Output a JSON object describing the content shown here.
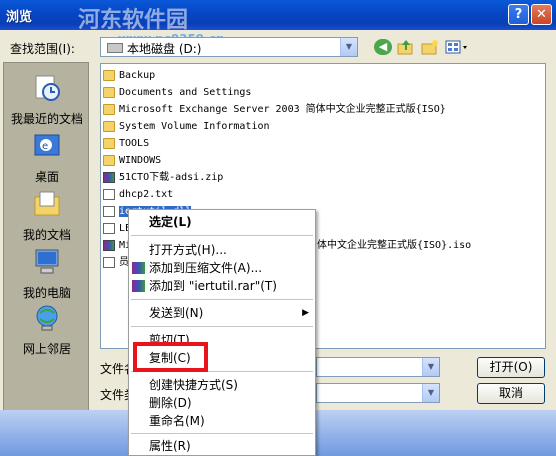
{
  "window": {
    "title": "浏览",
    "help_glyph": "?",
    "close_glyph": "✕",
    "watermark": "河东软件园",
    "watermark_url": "www.pc0359.cn"
  },
  "lookin": {
    "label": "查找范围(I):",
    "value": "本地磁盘 (D:)"
  },
  "places": [
    {
      "label": "我最近的文档",
      "icon": "recent-documents-icon"
    },
    {
      "label": "桌面",
      "icon": "desktop-icon"
    },
    {
      "label": "我的文档",
      "icon": "my-documents-icon"
    },
    {
      "label": "我的电脑",
      "icon": "my-computer-icon"
    },
    {
      "label": "网上邻居",
      "icon": "network-places-icon"
    }
  ],
  "files": [
    {
      "name": "Backup",
      "type": "folder"
    },
    {
      "name": "Documents and Settings",
      "type": "folder"
    },
    {
      "name": "Microsoft Exchange Server 2003 简体中文企业完整正式版{ISO}",
      "type": "folder"
    },
    {
      "name": "System Volume Information",
      "type": "folder"
    },
    {
      "name": "TOOLS",
      "type": "folder"
    },
    {
      "name": "WINDOWS",
      "type": "folder"
    },
    {
      "name": "51CTO下载-adsi.zip",
      "type": "zip"
    },
    {
      "name": "dhcp2.txt",
      "type": "txt"
    },
    {
      "name": "iertutil.dll",
      "type": "dll",
      "partial": "i"
    },
    {
      "name": "LE",
      "type": "file",
      "partial": "LE"
    },
    {
      "name": "Mi",
      "type": "iso",
      "partial": "Mi",
      "tail": "体中文企业完整正式版{ISO}.iso"
    },
    {
      "name": "员",
      "type": "file",
      "partial": "员"
    }
  ],
  "bottom": {
    "filename_label": "文件名",
    "filetype_label": "文件类",
    "open_button": "打开(O)",
    "cancel_button": "取消"
  },
  "context_menu": {
    "select": "选定(L)",
    "open_with": "打开方式(H)...",
    "add_archive": "添加到压缩文件(A)...",
    "add_to_rar": "添加到 \"iertutil.rar\"(T)",
    "send_to": "发送到(N)",
    "cut": "剪切(T)",
    "copy": "复制(C)",
    "create_shortcut": "创建快捷方式(S)",
    "delete": "删除(D)",
    "rename": "重命名(M)",
    "properties": "属性(R)"
  },
  "colors": {
    "titlebar": "#0a52d0",
    "highlight": "#e8141a",
    "selection": "#316ac5"
  }
}
